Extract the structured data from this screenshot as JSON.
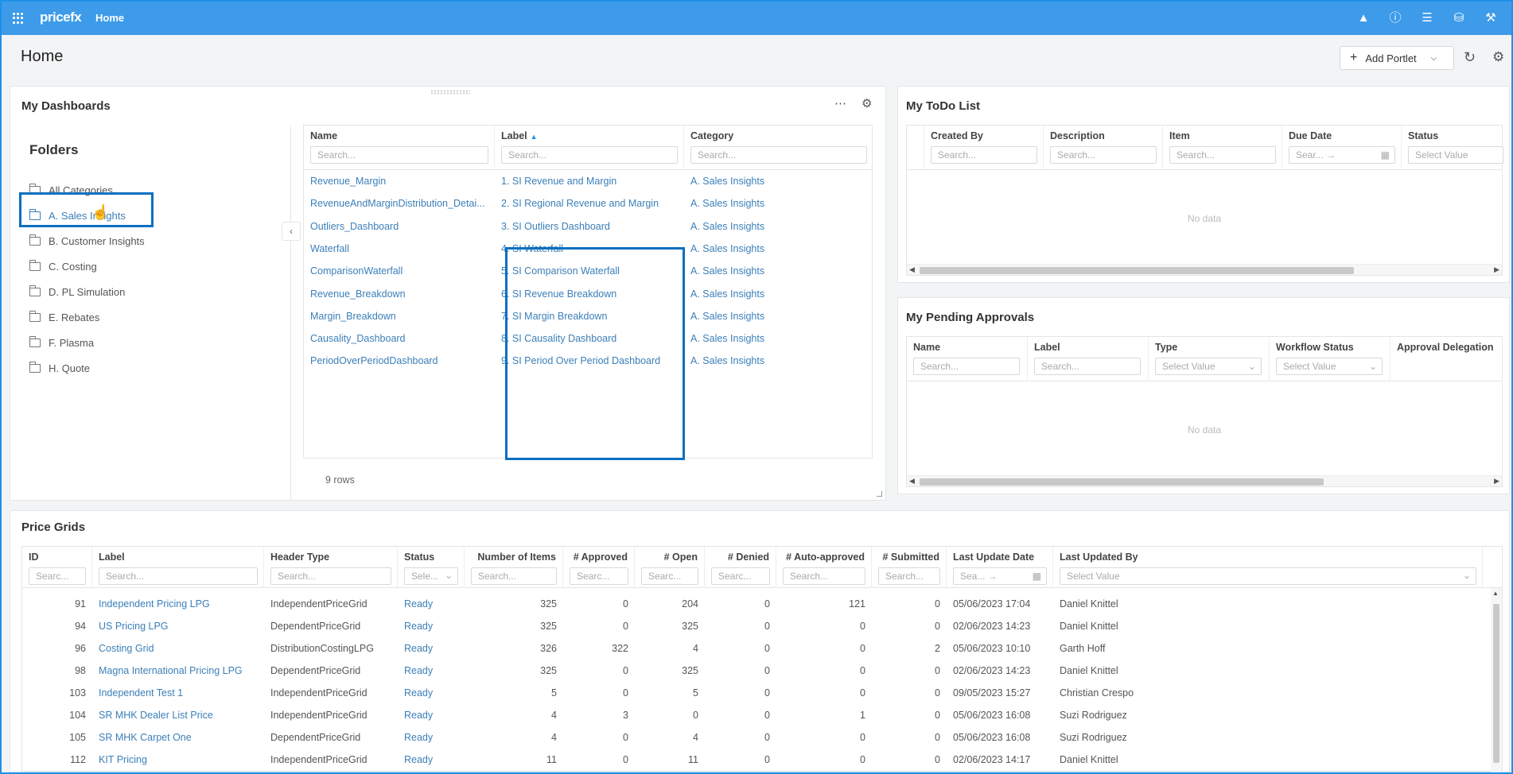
{
  "topbar": {
    "logo": "pricefx",
    "page": "Home",
    "icons": [
      "notification-icon",
      "help-icon",
      "sliders-icon",
      "database-icon",
      "tools-icon"
    ]
  },
  "header": {
    "title": "Home",
    "add_portlet": "Add Portlet"
  },
  "dashboards": {
    "title": "My Dashboards",
    "folders_title": "Folders",
    "folders": [
      "All Categories",
      "A. Sales Insights",
      "B. Customer Insights",
      "C. Costing",
      "D. PL Simulation",
      "E. Rebates",
      "F. Plasma",
      "H. Quote"
    ],
    "active_folder": "A. Sales Insights",
    "columns": [
      "Name",
      "Label",
      "Category"
    ],
    "search_placeholder": "Search...",
    "rows": [
      {
        "name": "Revenue_Margin",
        "label": "1. SI Revenue and Margin",
        "category": "A. Sales Insights"
      },
      {
        "name": "RevenueAndMarginDistribution_Detai...",
        "label": "2. SI Regional Revenue and Margin",
        "category": "A. Sales Insights"
      },
      {
        "name": "Outliers_Dashboard",
        "label": "3. SI Outliers Dashboard",
        "category": "A. Sales Insights"
      },
      {
        "name": "Waterfall",
        "label": "4. SI Waterfall",
        "category": "A. Sales Insights"
      },
      {
        "name": "ComparisonWaterfall",
        "label": "5. SI Comparison Waterfall",
        "category": "A. Sales Insights"
      },
      {
        "name": "Revenue_Breakdown",
        "label": "6. SI Revenue Breakdown",
        "category": "A. Sales Insights"
      },
      {
        "name": "Margin_Breakdown",
        "label": "7. SI Margin Breakdown",
        "category": "A. Sales Insights"
      },
      {
        "name": "Causality_Dashboard",
        "label": "8. SI Causality Dashboard",
        "category": "A. Sales Insights"
      },
      {
        "name": "PeriodOverPeriodDashboard",
        "label": "9. SI Period Over Period Dashboard",
        "category": "A. Sales Insights"
      }
    ],
    "row_count": "9 rows"
  },
  "todo": {
    "title": "My ToDo List",
    "columns": [
      "Created By",
      "Description",
      "Item",
      "Due Date",
      "Status"
    ],
    "search_placeholder": "Search...",
    "date_placeholder": "Sear...  →",
    "select_placeholder": "Select Value",
    "empty": "No data"
  },
  "approvals": {
    "title": "My Pending Approvals",
    "columns": [
      "Name",
      "Label",
      "Type",
      "Workflow Status",
      "Approval Delegation"
    ],
    "search_placeholder": "Search...",
    "select_placeholder": "Select Value",
    "empty": "No data"
  },
  "grids": {
    "title": "Price Grids",
    "columns": [
      "ID",
      "Label",
      "Header Type",
      "Status",
      "Number of Items",
      "# Approved",
      "# Open",
      "# Denied",
      "# Auto-approved",
      "# Submitted",
      "Last Update Date",
      "Last Updated By"
    ],
    "filters": [
      "Searc...",
      "Search...",
      "Search...",
      "Sele...",
      "Search...",
      "Searc...",
      "Searc...",
      "Searc...",
      "Search...",
      "Search...",
      "Sea... →",
      "Select Value"
    ],
    "rows": [
      {
        "id": "91",
        "label": "Independent Pricing LPG",
        "header_type": "IndependentPriceGrid",
        "status": "Ready",
        "items": "325",
        "approved": "0",
        "open": "204",
        "denied": "0",
        "auto": "121",
        "submitted": "0",
        "date": "05/06/2023 17:04",
        "by": "Daniel Knittel"
      },
      {
        "id": "94",
        "label": "US Pricing LPG",
        "header_type": "DependentPriceGrid",
        "status": "Ready",
        "items": "325",
        "approved": "0",
        "open": "325",
        "denied": "0",
        "auto": "0",
        "submitted": "0",
        "date": "02/06/2023 14:23",
        "by": "Daniel Knittel"
      },
      {
        "id": "96",
        "label": "Costing Grid",
        "header_type": "DistributionCostingLPG",
        "status": "Ready",
        "items": "326",
        "approved": "322",
        "open": "4",
        "denied": "0",
        "auto": "0",
        "submitted": "2",
        "date": "05/06/2023 10:10",
        "by": "Garth Hoff"
      },
      {
        "id": "98",
        "label": "Magna International Pricing LPG",
        "header_type": "DependentPriceGrid",
        "status": "Ready",
        "items": "325",
        "approved": "0",
        "open": "325",
        "denied": "0",
        "auto": "0",
        "submitted": "0",
        "date": "02/06/2023 14:23",
        "by": "Daniel Knittel"
      },
      {
        "id": "103",
        "label": "Independent Test 1",
        "header_type": "IndependentPriceGrid",
        "status": "Ready",
        "items": "5",
        "approved": "0",
        "open": "5",
        "denied": "0",
        "auto": "0",
        "submitted": "0",
        "date": "09/05/2023 15:27",
        "by": "Christian Crespo"
      },
      {
        "id": "104",
        "label": "SR MHK Dealer List Price",
        "header_type": "IndependentPriceGrid",
        "status": "Ready",
        "items": "4",
        "approved": "3",
        "open": "0",
        "denied": "0",
        "auto": "1",
        "submitted": "0",
        "date": "05/06/2023 16:08",
        "by": "Suzi Rodriguez"
      },
      {
        "id": "105",
        "label": "SR MHK Carpet One",
        "header_type": "DependentPriceGrid",
        "status": "Ready",
        "items": "4",
        "approved": "0",
        "open": "4",
        "denied": "0",
        "auto": "0",
        "submitted": "0",
        "date": "05/06/2023 16:08",
        "by": "Suzi Rodriguez"
      },
      {
        "id": "112",
        "label": "KIT Pricing",
        "header_type": "IndependentPriceGrid",
        "status": "Ready",
        "items": "11",
        "approved": "0",
        "open": "11",
        "denied": "0",
        "auto": "0",
        "submitted": "0",
        "date": "02/06/2023 14:17",
        "by": "Daniel Knittel"
      }
    ]
  }
}
